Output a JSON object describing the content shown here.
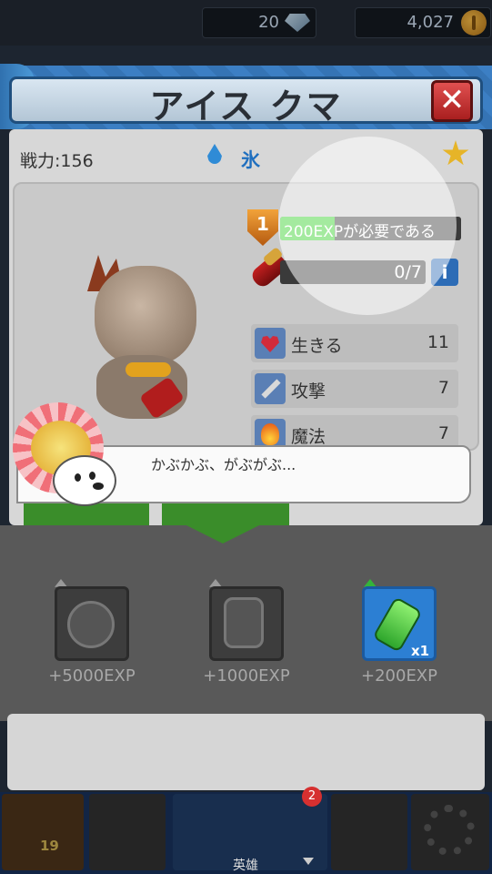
{
  "currency": {
    "gems": "20",
    "gold": "4,027"
  },
  "header": {
    "title": "アイス クマ",
    "close": "✕"
  },
  "hero": {
    "power": "戦力:156",
    "element": "氷",
    "level": "1",
    "exp_text": "200EXPが必要である",
    "exp_fill_percent": 30,
    "shards": "0/7",
    "info": "i",
    "stats": [
      {
        "label": "生きる",
        "value": "11",
        "icon": "heart-icon"
      },
      {
        "label": "攻撃",
        "value": "7",
        "icon": "sword-icon"
      },
      {
        "label": "魔法",
        "value": "7",
        "icon": "flame-icon"
      }
    ]
  },
  "dialog": {
    "text": "かぶかぶ、がぶがぶ..."
  },
  "items": [
    {
      "exp": "+5000EXP",
      "icon": "gourd-potion-icon",
      "available": false
    },
    {
      "exp": "+1000EXP",
      "icon": "jar-potion-icon",
      "available": false
    },
    {
      "exp": "+200EXP",
      "icon": "green-potion-icon",
      "available": true,
      "qty": "x1"
    }
  ],
  "nav": {
    "heroes_label": "英雄",
    "heroes_badge": "2",
    "chest_count": "19"
  }
}
